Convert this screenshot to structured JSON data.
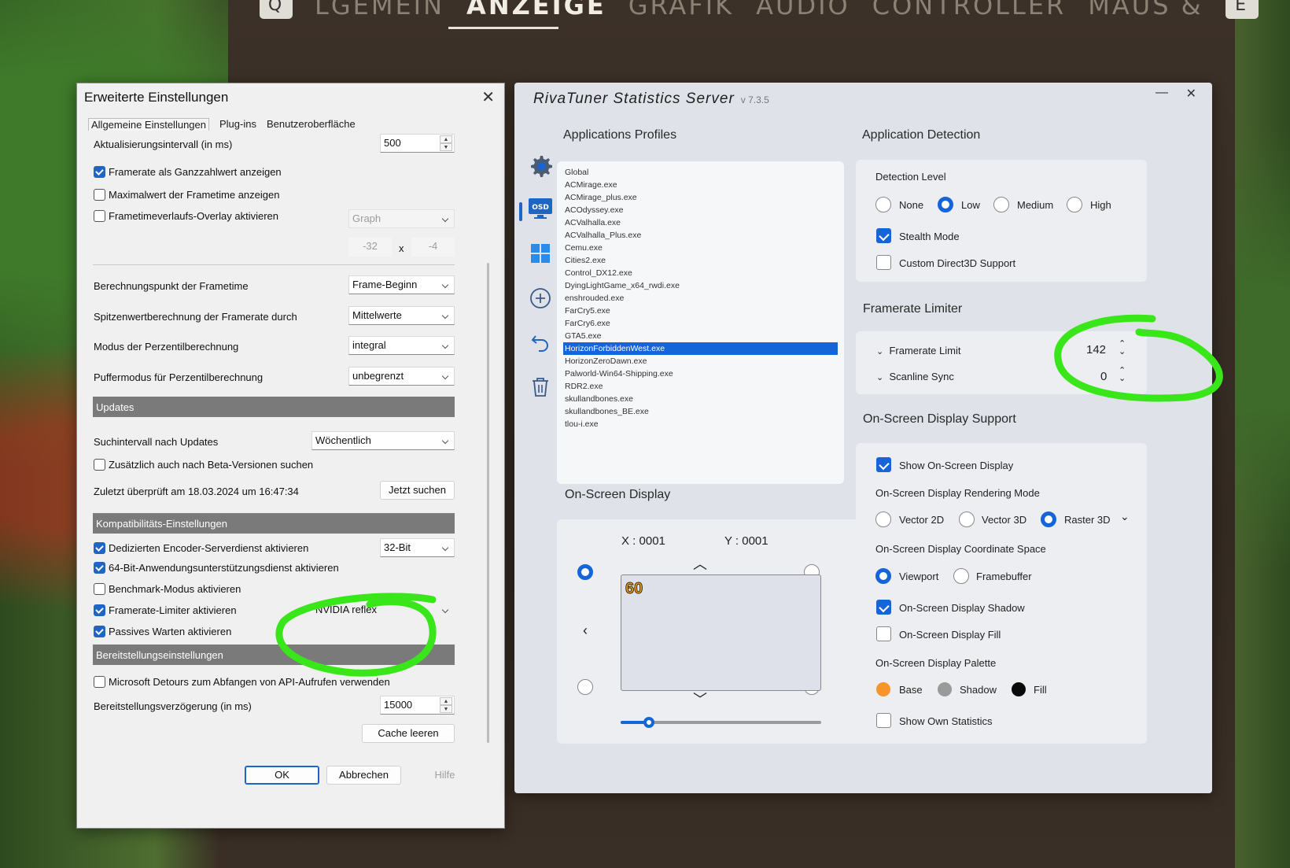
{
  "game": {
    "tabs": [
      "Q",
      "LGEMEIN",
      "ANZEIGE",
      "GRAFIK",
      "AUDIO",
      "CONTROLLER",
      "MAUS &",
      "E"
    ]
  },
  "dialog": {
    "title": "Erweiterte Einstellungen",
    "close": "✕",
    "tabs": [
      "Allgemeine Einstellungen",
      "Plug-ins",
      "Benutzeroberfläche"
    ],
    "update_interval_label": "Aktualisierungsintervall (in ms)",
    "update_interval_value": "500",
    "cb_framerate_int": "Framerate als Ganzzahlwert anzeigen",
    "cb_max_frametime": "Maximalwert der Frametime anzeigen",
    "cb_frametime_overlay": "Frametimeverlaufs-Overlay aktivieren",
    "graph_value": "Graph",
    "size_x": "-32",
    "size_sep": "x",
    "size_y": "-4",
    "calc_point_label": "Berechnungspunkt der Frametime",
    "calc_point_value": "Frame-Beginn",
    "peak_label": "Spitzenwertberechnung der Framerate durch",
    "peak_value": "Mittelwerte",
    "percentile_label": "Modus der Perzentilberechnung",
    "percentile_value": "integral",
    "buffer_label": "Puffermodus für Perzentilberechnung",
    "buffer_value": "unbegrenzt",
    "updates_header": "Updates",
    "search_interval_label": "Suchintervall nach Updates",
    "search_interval_value": "Wöchentlich",
    "cb_beta": "Zusätzlich auch nach Beta-Versionen suchen",
    "last_checked": "Zuletzt überprüft am 18.03.2024 um 16:47:34",
    "search_now": "Jetzt suchen",
    "compat_header": "Kompatibilitäts-Einstellungen",
    "cb_encoder": "Dedizierten Encoder-Serverdienst aktivieren",
    "encoder_value": "32-Bit",
    "cb_64bit": "64-Bit-Anwendungsunterstützungsdienst aktivieren",
    "cb_benchmark": "Benchmark-Modus aktivieren",
    "cb_limiter": "Framerate-Limiter aktivieren",
    "limiter_value": "NVIDIA reflex",
    "cb_passive": "Passives Warten aktivieren",
    "deploy_header": "Bereitstellungseinstellungen",
    "cb_detours": "Microsoft Detours zum Abfangen von API-Aufrufen verwenden",
    "deploy_delay_label": "Bereitstellungsverzögerung (in ms)",
    "deploy_delay_value": "15000",
    "clear_cache": "Cache leeren",
    "ok": "OK",
    "cancel": "Abbrechen",
    "help": "Hilfe"
  },
  "riva": {
    "title": "RivaTuner Statistics Server",
    "version": "v 7.3.5",
    "minimize": "—",
    "close": "✕",
    "side_osd": "OSD",
    "profiles_header": "Applications Profiles",
    "apps": [
      "Global",
      "ACMirage.exe",
      "ACMirage_plus.exe",
      "ACOdyssey.exe",
      "ACValhalla.exe",
      "ACValhalla_Plus.exe",
      "Cemu.exe",
      "Cities2.exe",
      "Control_DX12.exe",
      "DyingLightGame_x64_rwdi.exe",
      "enshrouded.exe",
      "FarCry5.exe",
      "FarCry6.exe",
      "GTA5.exe",
      "HorizonForbiddenWest.exe",
      "HorizonZeroDawn.exe",
      "Palworld-Win64-Shipping.exe",
      "RDR2.exe",
      "skullandbones.exe",
      "skullandbones_BE.exe",
      "tlou-i.exe"
    ],
    "osd_header": "On-Screen Display",
    "osd_x_label": "X :",
    "osd_x": "0001",
    "osd_y_label": "Y :",
    "osd_y": "0001",
    "osd_preview": "60",
    "detection_header": "Application Detection",
    "detection_level": "Detection Level",
    "det_none": "None",
    "det_low": "Low",
    "det_medium": "Medium",
    "det_high": "High",
    "stealth": "Stealth Mode",
    "custom_d3d": "Custom Direct3D Support",
    "limiter_header": "Framerate Limiter",
    "framerate_limit_label": "Framerate Limit",
    "framerate_limit_value": "142",
    "scanline_label": "Scanline Sync",
    "scanline_value": "0",
    "osd_support_header": "On-Screen Display Support",
    "show_osd": "Show On-Screen Display",
    "render_mode": "On-Screen Display Rendering Mode",
    "vector2d": "Vector 2D",
    "vector3d": "Vector 3D",
    "raster3d": "Raster 3D",
    "coord_space": "On-Screen Display Coordinate Space",
    "viewport": "Viewport",
    "framebuffer": "Framebuffer",
    "osd_shadow": "On-Screen Display Shadow",
    "osd_fill": "On-Screen Display Fill",
    "palette": "On-Screen Display Palette",
    "pal_base": "Base",
    "pal_shadow": "Shadow",
    "pal_fill": "Fill",
    "own_stats": "Show Own Statistics",
    "colors": {
      "accent": "#1565d8",
      "base": "#f5952a",
      "shadow": "#9a9a9a",
      "fill": "#0a0a0a",
      "annotation": "#39e619"
    }
  }
}
